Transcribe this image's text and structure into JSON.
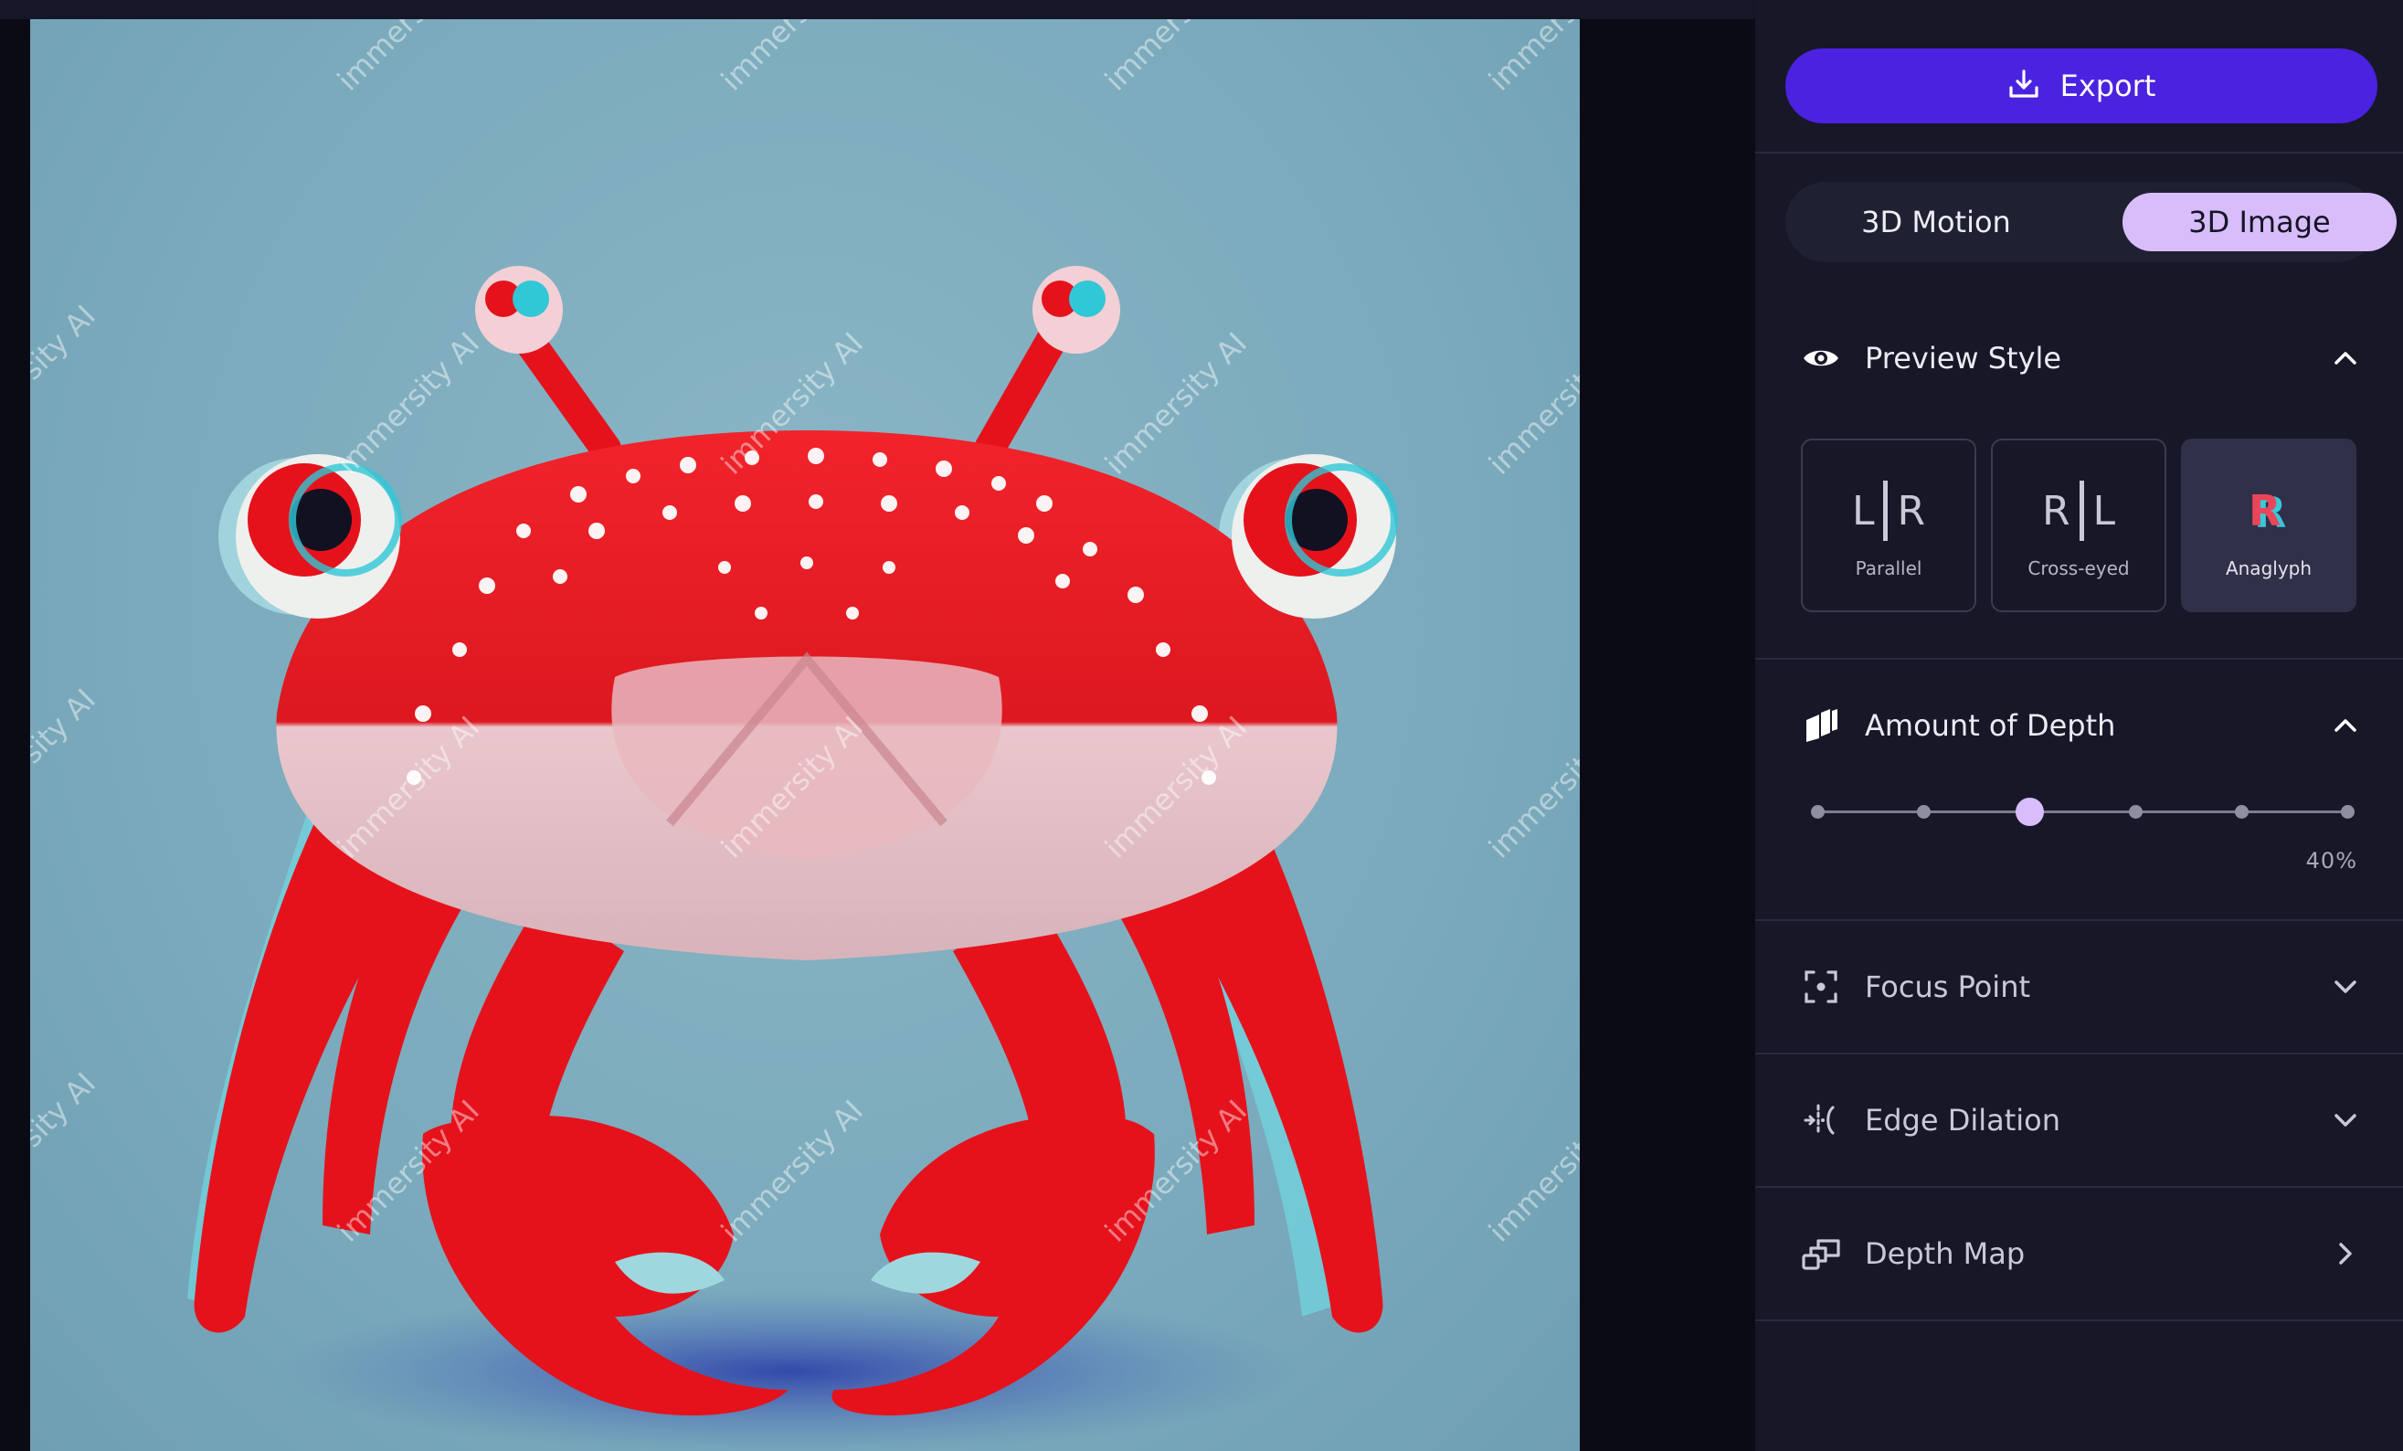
{
  "export": {
    "label": "Export",
    "icon": "download-icon"
  },
  "mode_tabs": [
    {
      "label": "3D Motion",
      "active": false
    },
    {
      "label": "3D Image",
      "active": true
    }
  ],
  "preview_style": {
    "title": "Preview Style",
    "icon": "eye-icon",
    "expanded": true,
    "options": [
      {
        "glyph_left": "L",
        "glyph_right": "R",
        "label": "Parallel",
        "selected": false
      },
      {
        "glyph_left": "R",
        "glyph_right": "L",
        "label": "Cross-eyed",
        "selected": false
      },
      {
        "glyph": "R",
        "label": "Anaglyph",
        "selected": true
      }
    ]
  },
  "depth": {
    "title": "Amount of Depth",
    "icon": "depth-layers-icon",
    "expanded": true,
    "value_label": "40%",
    "value": 0.4,
    "steps": 6,
    "selected_step": 2
  },
  "sections": [
    {
      "title": "Focus Point",
      "icon": "focus-point-icon",
      "chevron": "chevron-down-icon"
    },
    {
      "title": "Edge Dilation",
      "icon": "edge-dilation-icon",
      "chevron": "chevron-down-icon"
    },
    {
      "title": "Depth Map",
      "icon": "depth-map-icon",
      "chevron": "chevron-right-icon"
    }
  ],
  "watermark": "immersity AI",
  "colors": {
    "accent": "#4b22e0",
    "tab_active": "#d9bdfb",
    "panel": "#171728",
    "crab_red": "#e5121c",
    "backdrop": "#7aaabc"
  }
}
